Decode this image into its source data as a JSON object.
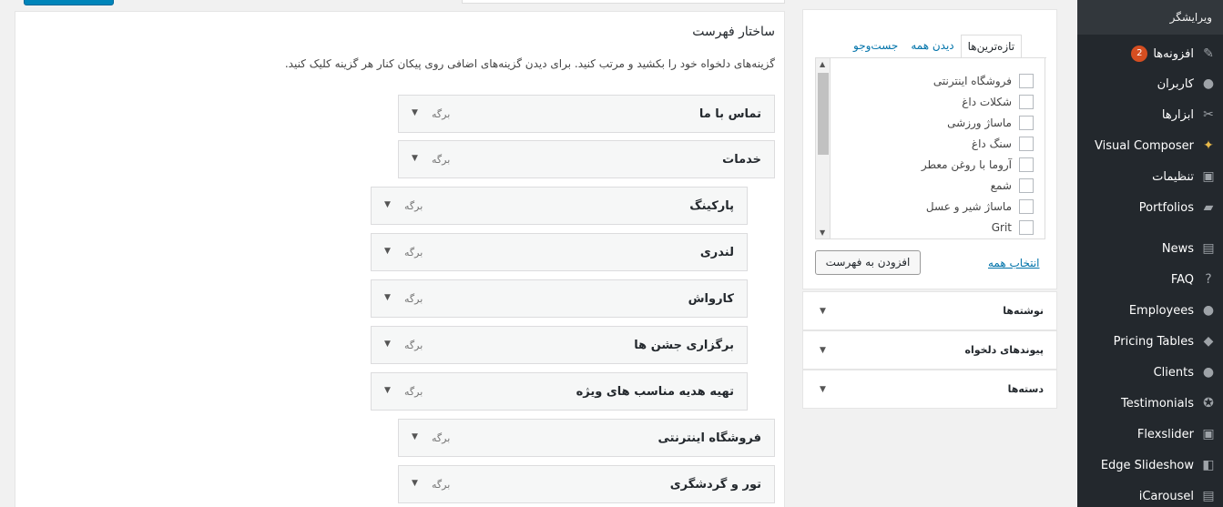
{
  "sidebar": {
    "header": "ویرایشگر",
    "items": [
      {
        "label": "افزونه‌ها",
        "icon": "plugin-icon",
        "badge": "2"
      },
      {
        "label": "کاربران",
        "icon": "users-icon"
      },
      {
        "label": "ابزارها",
        "icon": "tools-icon"
      },
      {
        "label": "Visual Composer",
        "icon": "visual-composer-icon"
      },
      {
        "label": "تنظیمات",
        "icon": "settings-icon"
      },
      {
        "label": "Portfolios",
        "icon": "folder-icon"
      },
      {
        "label": "News",
        "icon": "news-icon"
      },
      {
        "label": "FAQ",
        "icon": "help-icon"
      },
      {
        "label": "Employees",
        "icon": "groups-icon"
      },
      {
        "label": "Pricing Tables",
        "icon": "tag-icon"
      },
      {
        "label": "Clients",
        "icon": "person-icon"
      },
      {
        "label": "Testimonials",
        "icon": "award-icon"
      },
      {
        "label": "Flexslider",
        "icon": "image-icon"
      },
      {
        "label": "Edge Slideshow",
        "icon": "slides-icon"
      },
      {
        "label": "iCarousel",
        "icon": "carousel-icon"
      }
    ]
  },
  "structure": {
    "title": "ساختار فهرست",
    "description": "گزینه‌های دلخواه خود را بکشید و مرتب کنید. برای دیدن گزینه‌های اضافی روی پیکان کنار هر گزینه کلیک کنید.",
    "items": [
      {
        "title": "تماس با ما",
        "type": "برگه"
      },
      {
        "title": "خدمات",
        "type": "برگه"
      },
      {
        "title": "پارکینگ",
        "type": "برگه"
      },
      {
        "title": "لندری",
        "type": "برگه"
      },
      {
        "title": "کارواش",
        "type": "برگه"
      },
      {
        "title": "برگزاری جشن ها",
        "type": "برگه"
      },
      {
        "title": "تهیه هدیه مناسب های ویژه",
        "type": "برگه"
      },
      {
        "title": "فروشگاه اینترنتی",
        "type": "برگه"
      },
      {
        "title": "تور و گردشگری",
        "type": "برگه"
      }
    ]
  },
  "pages_box": {
    "tabs": [
      "تازه‌ترین‌ها",
      "دیدن همه",
      "جست‌وجو"
    ],
    "checklist": [
      "فروشگاه اینترنتی",
      "شکلات داغ",
      "ماساژ ورزشی",
      "سنگ داغ",
      "آروما با روغن معطر",
      "شمع",
      "ماساژ شیر و عسل",
      "Grit"
    ],
    "select_all": "انتخاب همه",
    "add_button": "افزودن به فهرست"
  },
  "accordions": [
    "نوشته‌ها",
    "پیوندهای دلخواه",
    "دسته‌ها"
  ],
  "colors": {
    "sidebar_bg": "#23282d",
    "accent": "#0073aa",
    "badge": "#d54e21"
  }
}
